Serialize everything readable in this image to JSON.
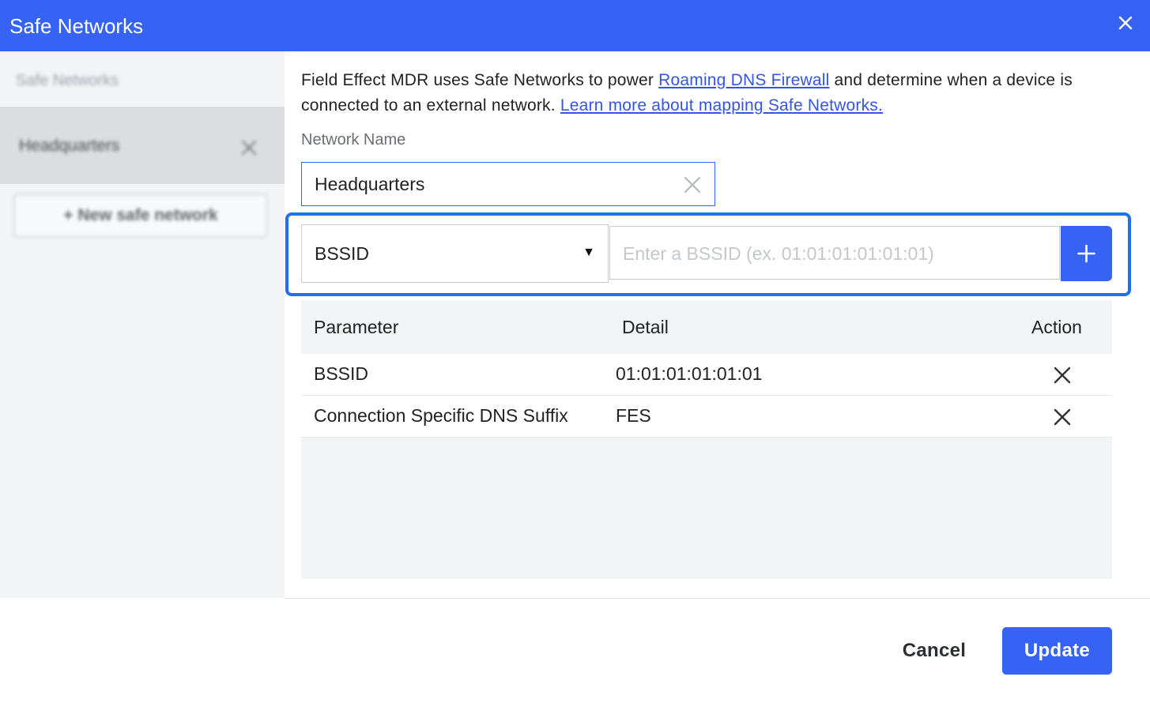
{
  "dialog": {
    "title": "Safe Networks"
  },
  "sidebar": {
    "header": "Safe Networks",
    "items": [
      {
        "label": "Headquarters"
      }
    ],
    "new_button_label": "+ New safe network"
  },
  "main": {
    "description": {
      "part1": "Field Effect MDR uses Safe Networks to power ",
      "link1": "Roaming DNS Firewall",
      "part2": " and determine when a device is connected to an external network. ",
      "link2": "Learn more about mapping Safe Networks."
    },
    "network_name": {
      "label": "Network Name",
      "value": "Headquarters"
    },
    "parameter_select": {
      "selected": "BSSID"
    },
    "bssid_input": {
      "placeholder": "Enter a BSSID (ex. 01:01:01:01:01:01)"
    },
    "table": {
      "headers": [
        "Parameter",
        "Detail",
        "Action"
      ],
      "rows": [
        {
          "parameter": "BSSID",
          "detail": "01:01:01:01:01:01"
        },
        {
          "parameter": "Connection Specific DNS Suffix",
          "detail": "FES"
        }
      ]
    }
  },
  "footer": {
    "cancel_label": "Cancel",
    "update_label": "Update"
  },
  "colors": {
    "accent": "#3763f4",
    "focus_ring": "#1e6ff1",
    "link": "#3456e8"
  }
}
